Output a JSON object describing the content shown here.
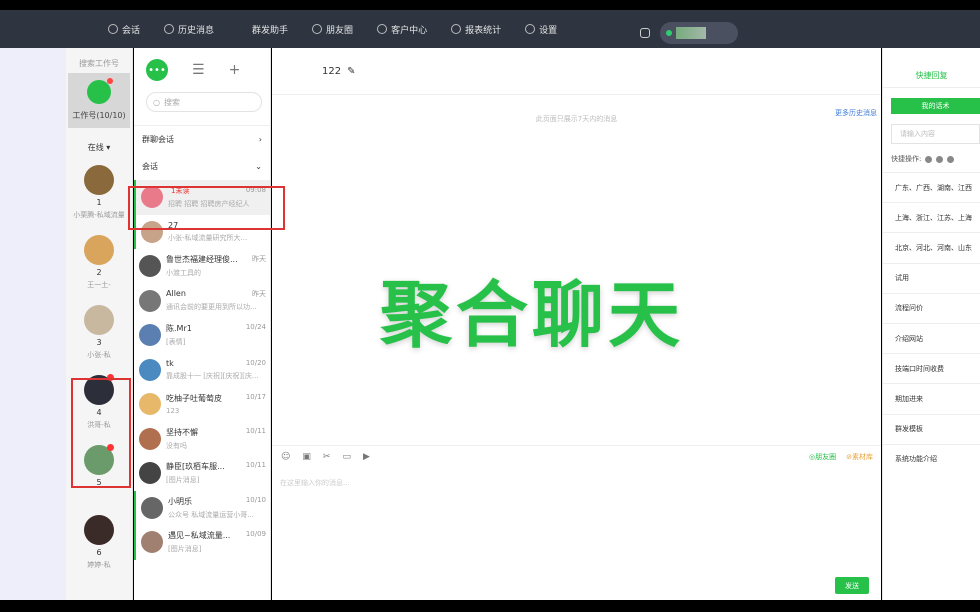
{
  "topnav": [
    {
      "label": "会话",
      "icon": "chat-icon"
    },
    {
      "label": "历史消息",
      "icon": "clock-icon"
    },
    {
      "label": "群发助手",
      "icon": ""
    },
    {
      "label": "朋友圈",
      "icon": "moments-icon"
    },
    {
      "label": "客户中心",
      "icon": "user-icon"
    },
    {
      "label": "报表统计",
      "icon": "bar-chart-icon"
    },
    {
      "label": "设置",
      "icon": "gear-icon"
    }
  ],
  "worker": {
    "title": "搜索工作号",
    "count_label": "工作号(10/10)",
    "status": "在线"
  },
  "accounts": [
    {
      "num": "1",
      "name": "小栗腾-私域流量",
      "color": "#8a6a3c",
      "badge": false
    },
    {
      "num": "2",
      "name": "王一土-",
      "color": "#d9a55c",
      "badge": false
    },
    {
      "num": "3",
      "name": "小张-私",
      "color": "#c9b8a0",
      "badge": false
    },
    {
      "num": "4",
      "name": "洪哥-私",
      "color": "#2c2f3a",
      "badge": true
    },
    {
      "num": "5",
      "name": "",
      "color": "#6b9a6b",
      "badge": true
    },
    {
      "num": "6",
      "name": "婷婷-私",
      "color": "#3a2a28",
      "badge": false
    }
  ],
  "chats": {
    "search_placeholder": "搜索",
    "group_label": "群聊会话",
    "session_label": "会话",
    "items": [
      {
        "name": "",
        "tag": "1未读",
        "time": "09:08",
        "preview": "招聘 招聘 招聘房产经纪人",
        "color": "#e87a8a"
      },
      {
        "name": "27",
        "tag": "",
        "time": "",
        "preview": "小张-私域流量研究所大...",
        "color": "#c7a38a"
      },
      {
        "name": "鲁世杰福建经理俊...",
        "tag": "",
        "time": "昨天",
        "preview": "小渡工具的",
        "color": "#555"
      },
      {
        "name": "Allen",
        "tag": "",
        "time": "昨天",
        "preview": "通讯会前的要更用到所以功...",
        "color": "#777"
      },
      {
        "name": "陈.Mr1",
        "tag": "",
        "time": "10/24",
        "preview": "[表情]",
        "color": "#5b7fb0"
      },
      {
        "name": "tk",
        "tag": "",
        "time": "10/20",
        "preview": "靠成股十一 [庆祝][庆祝][庆...",
        "color": "#4a8ac0"
      },
      {
        "name": "吃柚子吐葡萄皮",
        "tag": "",
        "time": "10/17",
        "preview": "123",
        "color": "#e8b86a"
      },
      {
        "name": "坚持不懈",
        "tag": "",
        "time": "10/11",
        "preview": "没有吗",
        "color": "#b07050"
      },
      {
        "name": "静臣[玖栢车服...",
        "tag": "",
        "time": "10/11",
        "preview": "[图片消息]",
        "color": "#444"
      },
      {
        "name": "小明乐",
        "tag": "",
        "time": "10/10",
        "preview": "公众号 私域流量运营小哥...",
        "color": "#666"
      },
      {
        "name": "遇见~私域流量...",
        "tag": "",
        "time": "10/09",
        "preview": "[图片消息]",
        "color": "#a08070"
      }
    ]
  },
  "main": {
    "title": "122",
    "history_link": "更多历史消息",
    "notice": "此页面只展示7天内的消息",
    "overlay_title": "聚合聊天",
    "tool_right_1": "◎朋友圈",
    "tool_right_2": "⊘素材库",
    "input_placeholder": "在这里输入你的消息...",
    "send_label": "发送"
  },
  "quick": {
    "tab_label": "快捷回复",
    "my_button": "我的话术",
    "input_placeholder": "请输入内容",
    "ops_label": "快捷操作:",
    "items": [
      "广东、广西、湖南、江西",
      "上海、浙江、江苏、上海",
      "北京、河北、河南、山东",
      "试用",
      "流程问价",
      "介绍网站",
      "技端口时间收费",
      "期加进来",
      "群发模板",
      "系统功能介绍"
    ]
  }
}
